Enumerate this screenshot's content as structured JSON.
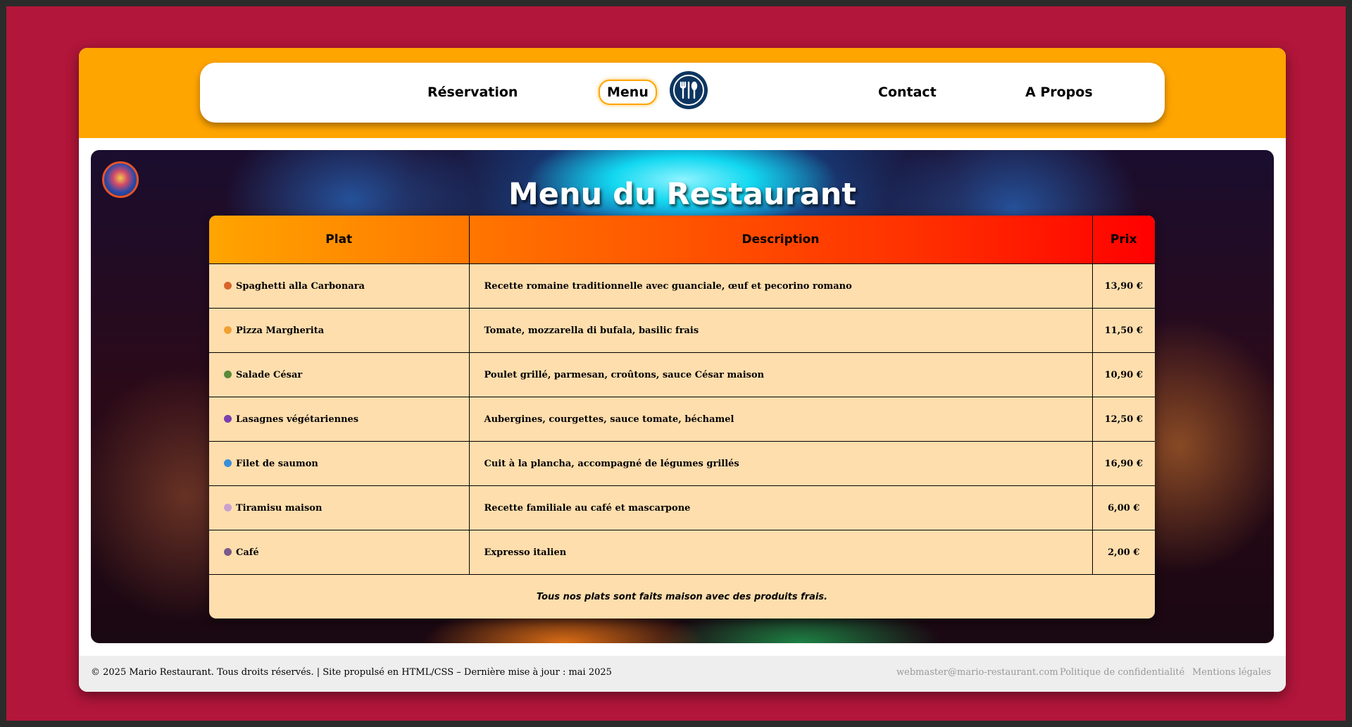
{
  "nav": {
    "items": [
      {
        "label": "Réservation"
      },
      {
        "label": "Menu"
      },
      {
        "label": "Contact"
      },
      {
        "label": "A Propos"
      }
    ],
    "logo_icon": "fork-knife-spoon-icon"
  },
  "hero": {
    "title": "Menu du Restaurant"
  },
  "table": {
    "headers": [
      "Plat",
      "Description",
      "Prix"
    ],
    "rows": [
      {
        "icon": "spaghetti-icon",
        "icon_color": "#d9642a",
        "name": "Spaghetti alla Carbonara",
        "description": "Recette romaine traditionnelle avec guanciale, œuf et pecorino romano",
        "price": "13,90 €"
      },
      {
        "icon": "pizza-icon",
        "icon_color": "#f0a030",
        "name": "Pizza Margherita",
        "description": "Tomate, mozzarella di bufala, basilic frais",
        "price": "11,50 €"
      },
      {
        "icon": "salad-icon",
        "icon_color": "#5a8a3a",
        "name": "Salade César",
        "description": "Poulet grillé, parmesan, croûtons, sauce César maison",
        "price": "10,90 €"
      },
      {
        "icon": "eggplant-icon",
        "icon_color": "#7a3fb0",
        "name": "Lasagnes végétariennes",
        "description": "Aubergines, courgettes, sauce tomate, béchamel",
        "price": "12,50 €"
      },
      {
        "icon": "fish-icon",
        "icon_color": "#3a8fd9",
        "name": "Filet de saumon",
        "description": "Cuit à la plancha, accompagné de légumes grillés",
        "price": "16,90 €"
      },
      {
        "icon": "cake-icon",
        "icon_color": "#c9a0d0",
        "name": "Tiramisu maison",
        "description": "Recette familiale au café et mascarpone",
        "price": "6,00 €"
      },
      {
        "icon": "coffee-icon",
        "icon_color": "#7a5a8a",
        "name": "Café",
        "description": "Expresso italien",
        "price": "2,00 €"
      }
    ],
    "note": "Tous nos plats sont faits maison avec des produits frais."
  },
  "footer": {
    "copyright": "© 2025 Mario Restaurant. Tous droits réservés. | Site propulsé en HTML/CSS – Dernière mise à jour : mai 2025",
    "email": "webmaster@mario-restaurant.com",
    "privacy": "Politique de confidentialité",
    "legal": "Mentions légales"
  }
}
